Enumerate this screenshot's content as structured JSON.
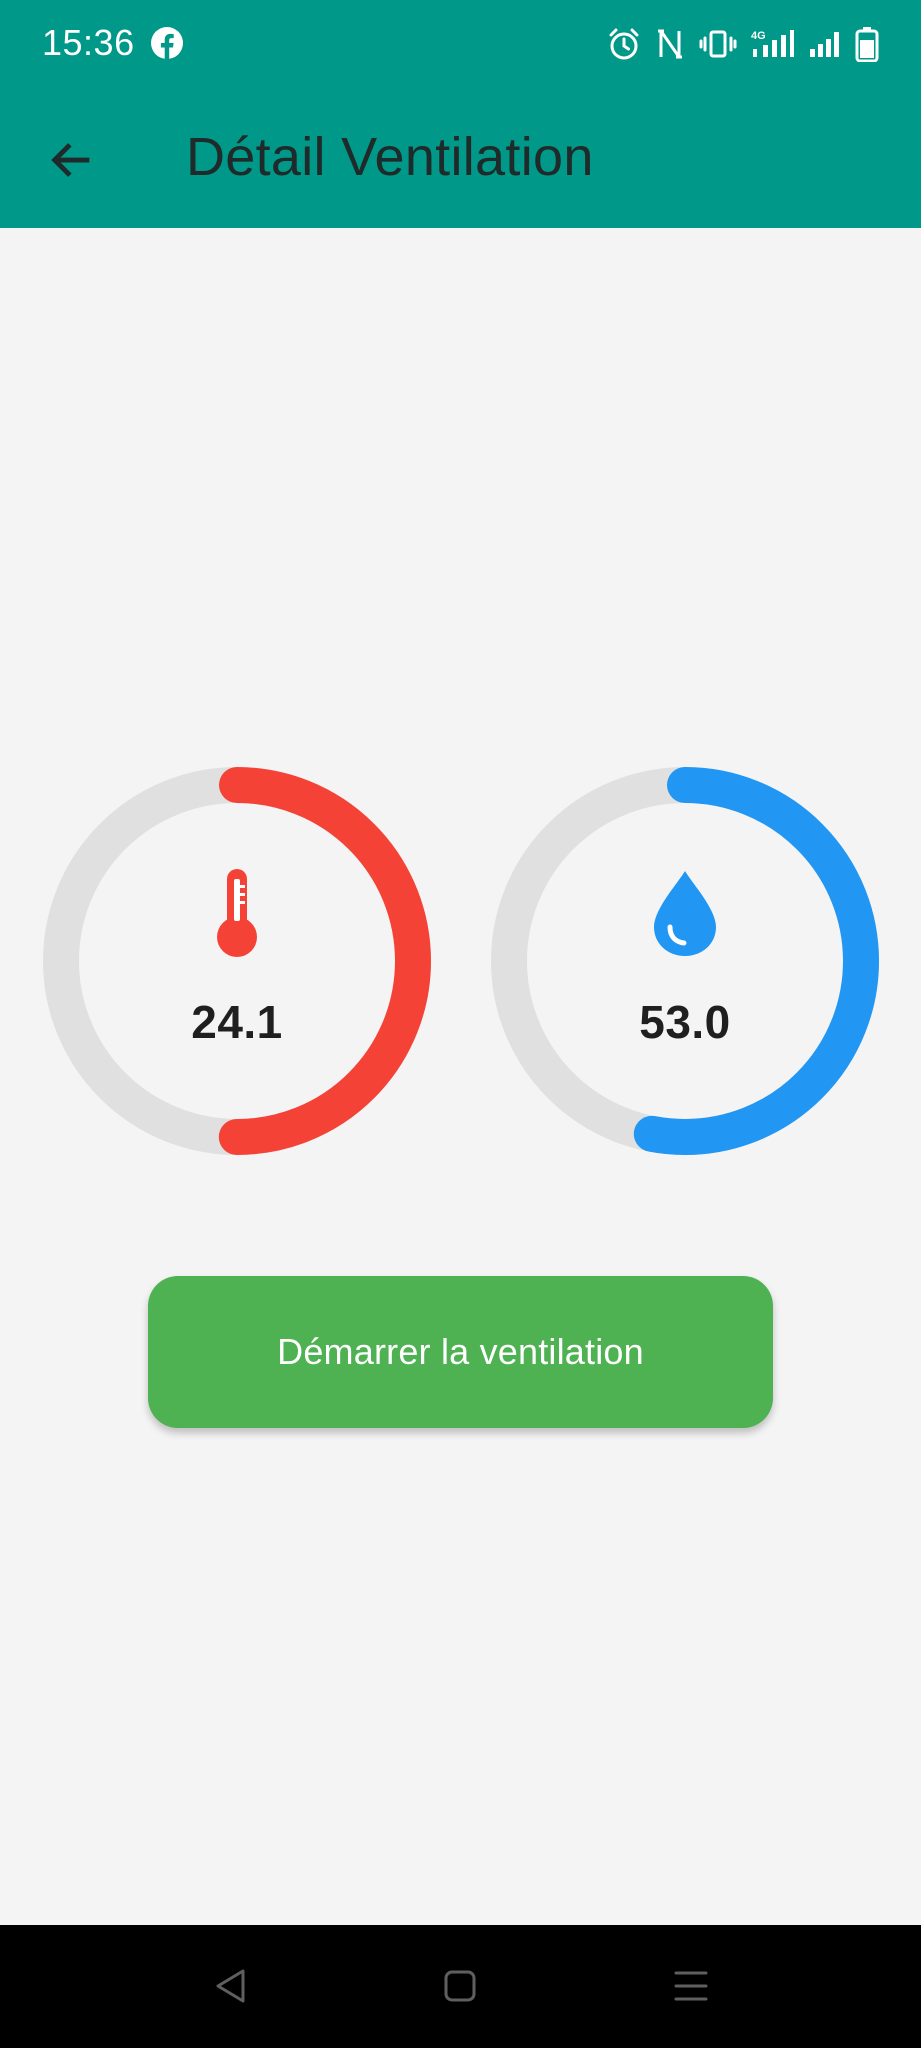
{
  "status_bar": {
    "time": "15:36",
    "icons": [
      "facebook-icon",
      "alarm-icon",
      "nfc-icon",
      "vibrate-icon",
      "4g-signal-icon",
      "signal-icon",
      "battery-icon"
    ],
    "network_label": "4G"
  },
  "app_bar": {
    "title": "Détail Ventilation",
    "back_icon": "arrow-left-icon"
  },
  "gauges": [
    {
      "name": "temperature",
      "value": "24.1",
      "fill_fraction": 0.5,
      "icon": "thermometer-icon",
      "color": "#f44336",
      "track_color": "#e0e0e0"
    },
    {
      "name": "humidity",
      "value": "53.0",
      "fill_fraction": 0.53,
      "icon": "water-drop-icon",
      "color": "#2196f3",
      "track_color": "#e0e0e0"
    }
  ],
  "actions": {
    "start_label": "Démarrer la ventilation",
    "start_color": "#4eb152"
  },
  "nav_bar": {
    "icons": [
      "nav-back-icon",
      "nav-home-icon",
      "nav-menu-icon"
    ]
  },
  "colors": {
    "app_bar": "#009888",
    "background": "#f4f4f5"
  }
}
